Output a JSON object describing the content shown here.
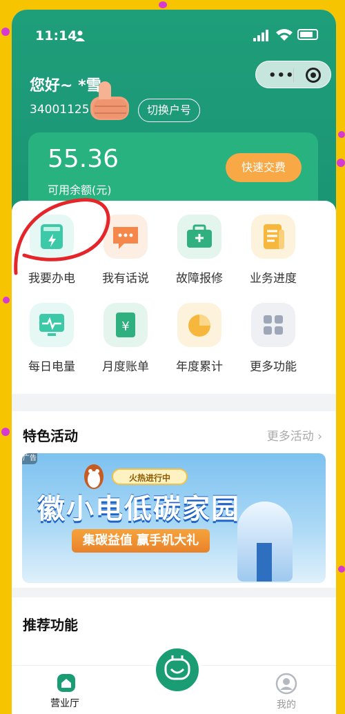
{
  "status": {
    "time": "11:14"
  },
  "header": {
    "greeting": "您好~ *雪",
    "account_number": "34001125",
    "switch_label": "切换户号",
    "capsule": {
      "more_label": "•••"
    }
  },
  "balance": {
    "amount": "55.36",
    "label": "可用余额(元)",
    "pay_label": "快速交费"
  },
  "services": [
    {
      "label": "我要办电",
      "icon": "electric-meter-icon",
      "color": "#3cc9a8"
    },
    {
      "label": "我有话说",
      "icon": "chat-icon",
      "color": "#f5874a"
    },
    {
      "label": "故障报修",
      "icon": "toolbox-icon",
      "color": "#2fb07e"
    },
    {
      "label": "业务进度",
      "icon": "document-icon",
      "color": "#f7b73c"
    },
    {
      "label": "每日电量",
      "icon": "monitor-pulse-icon",
      "color": "#3cc9a8"
    },
    {
      "label": "月度账单",
      "icon": "bill-yuan-icon",
      "color": "#2fb07e"
    },
    {
      "label": "年度累计",
      "icon": "pie-chart-icon",
      "color": "#f7b73c"
    },
    {
      "label": "更多功能",
      "icon": "grid-more-icon",
      "color": "#9ea7b8"
    }
  ],
  "activities": {
    "title": "特色活动",
    "more_label": "更多活动 ›",
    "banner": {
      "ad_tag": "广告",
      "status_label": "火热进行中",
      "title": "徽小电低碳家园",
      "subtitle": "集碳益值 赢手机大礼"
    }
  },
  "recommend": {
    "title": "推荐功能"
  },
  "tabbar": {
    "home_label": "营业厅",
    "mine_label": "我的",
    "active_color": "#1a9d72"
  }
}
